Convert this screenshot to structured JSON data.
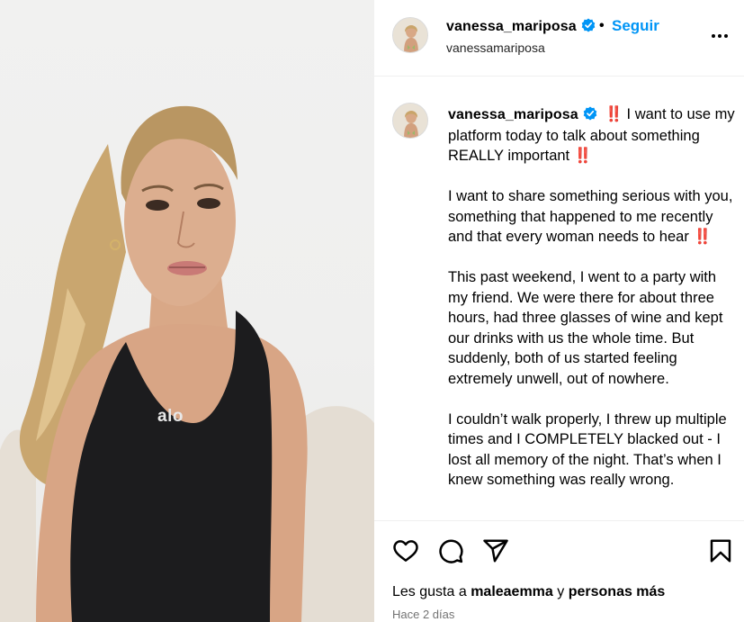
{
  "post": {
    "media_alt": "Video frame",
    "shirt_logo": "alo"
  },
  "header": {
    "username": "vanessa_mariposa",
    "separator": "•",
    "follow_label": "Seguir",
    "subtitle": "vanessamariposa"
  },
  "caption": {
    "username": "vanessa_mariposa",
    "paragraphs": [
      "I want to use my platform today to talk about something REALLY important",
      "I want to share something serious with you, something that happened to me recently and that every woman needs to hear",
      "This past weekend, I went to a party with my friend. We were there for about three hours, had three glasses of wine and kept our drinks with us the whole time. But suddenly, both of us started feeling extremely unwell, out of nowhere.",
      "I couldn’t walk properly, I threw up multiple times and I COMPLETELY blacked out - I lost all memory of the night. That’s when I knew something was really wrong."
    ],
    "emphasis": "‼️"
  },
  "footer": {
    "likes_prefix": "Les gusta a",
    "liker": "maleaemma",
    "likes_joiner": "y",
    "likes_others": "personas más",
    "timestamp": "Hace 2 días"
  },
  "icons": {
    "verified": "verified-badge-icon",
    "more": "more-options-icon",
    "like": "heart-icon",
    "comment": "comment-icon",
    "share": "share-icon",
    "save": "bookmark-icon"
  },
  "colors": {
    "accent": "#0095f6",
    "verified": "#0095f6",
    "emphasis": "#e0245e",
    "muted": "#737373"
  }
}
